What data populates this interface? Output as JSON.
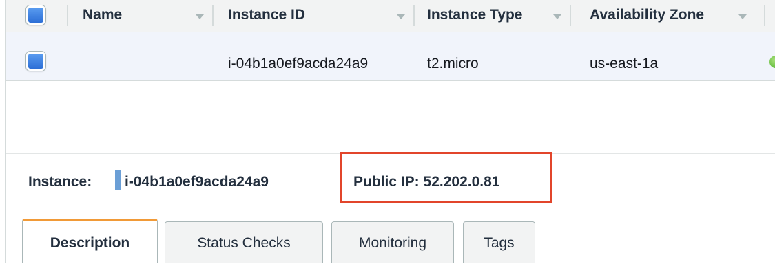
{
  "table": {
    "columns": [
      {
        "label": "Name"
      },
      {
        "label": "Instance ID"
      },
      {
        "label": "Instance Type"
      },
      {
        "label": "Availability Zone"
      }
    ],
    "row": {
      "name": "",
      "instance_id": "i-04b1a0ef9acda24a9",
      "instance_type": "t2.micro",
      "availability_zone": "us-east-1a",
      "status_color": "#4caf2a"
    }
  },
  "details": {
    "instance_label": "Instance:",
    "instance_id": "i-04b1a0ef9acda24a9",
    "public_ip_text": "Public IP: 52.202.0.81",
    "highlight_color": "#e2452b"
  },
  "tabs": [
    {
      "label": "Description",
      "active": true
    },
    {
      "label": "Status Checks",
      "active": false
    },
    {
      "label": "Monitoring",
      "active": false
    },
    {
      "label": "Tags",
      "active": false
    }
  ],
  "accent_color": "#f19a37"
}
